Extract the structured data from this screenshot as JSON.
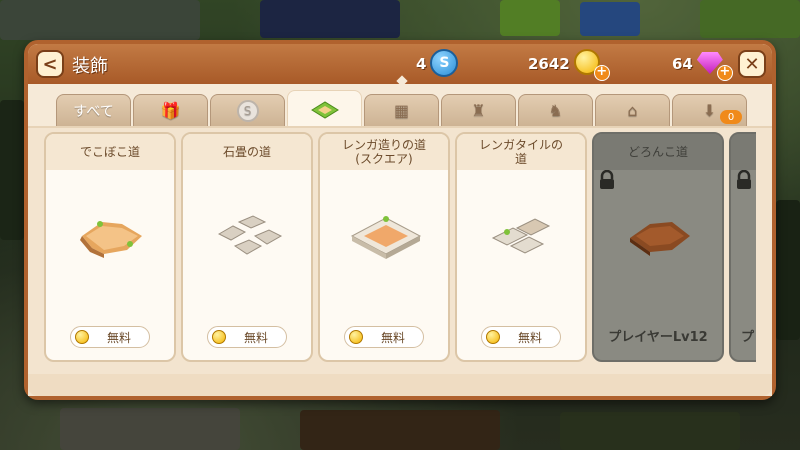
{
  "header": {
    "back_label": "<",
    "title": "装飾",
    "close_label": "✕"
  },
  "currencies": {
    "premium_coins": "4",
    "premium_coin_symbol": "S",
    "gold": "2642",
    "gems": "64"
  },
  "tabs": [
    {
      "label": "すべて",
      "icon": null,
      "active": false
    },
    {
      "label": "",
      "icon": "gift-hourglass-icon",
      "active": false
    },
    {
      "label": "",
      "icon": "silver-coin-icon",
      "active": false
    },
    {
      "label": "",
      "icon": "road-tile-icon",
      "active": true
    },
    {
      "label": "",
      "icon": "fence-icon",
      "active": false
    },
    {
      "label": "",
      "icon": "statue-icon",
      "active": false
    },
    {
      "label": "",
      "icon": "fountain-statue-icon",
      "active": false
    },
    {
      "label": "",
      "icon": "gazebo-icon",
      "active": false
    },
    {
      "label": "",
      "icon": "storage-download-icon",
      "active": false,
      "badge": "0"
    }
  ],
  "items": [
    {
      "name": "でこぼこ道",
      "price": "無料",
      "locked": false,
      "icon": "bumpy-road-icon"
    },
    {
      "name": "石畳の道",
      "price": "無料",
      "locked": false,
      "icon": "cobblestone-road-icon"
    },
    {
      "name": "レンガ造りの道\n(スクエア)",
      "price": "無料",
      "locked": false,
      "icon": "brick-square-road-icon"
    },
    {
      "name": "レンガタイルの\n道",
      "price": "無料",
      "locked": false,
      "icon": "brick-tile-road-icon"
    },
    {
      "name": "どろんこ道",
      "requirement": "プレイヤーLv12",
      "locked": true,
      "icon": "mud-road-icon"
    },
    {
      "name": "",
      "requirement": "プ",
      "locked": true,
      "icon": "lock-icon"
    }
  ],
  "colors": {
    "header": "#b0622e",
    "panel": "#f6ead8",
    "accent_orange": "#f08a1a",
    "locked_card": "#8a8a82"
  }
}
